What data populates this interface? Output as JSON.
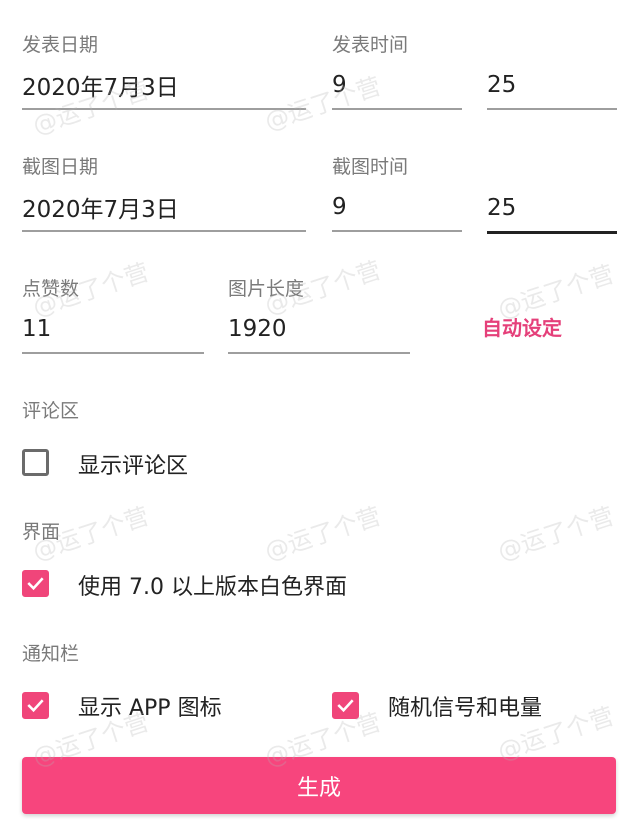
{
  "publish": {
    "date_label": "发表日期",
    "date_value": "2020年7月3日",
    "time_label": "发表时间",
    "hour": "9",
    "minute": "25"
  },
  "screenshot": {
    "date_label": "截图日期",
    "date_value": "2020年7月3日",
    "time_label": "截图时间",
    "hour": "9",
    "minute": "25"
  },
  "likes": {
    "label": "点赞数",
    "value": "11"
  },
  "image_length": {
    "label": "图片长度",
    "value": "1920"
  },
  "auto_set_label": "自动设定",
  "comments": {
    "section_label": "评论区",
    "show_label": "显示评论区",
    "checked": false
  },
  "interface": {
    "section_label": "界面",
    "white_ui_label": "使用 7.0 以上版本白色界面",
    "checked": true
  },
  "notification": {
    "section_label": "通知栏",
    "show_app_icon_label": "显示 APP 图标",
    "show_app_icon_checked": true,
    "random_signal_label": "随机信号和电量",
    "random_signal_checked": true
  },
  "generate_label": "生成",
  "watermark_text": "@运了个营",
  "colors": {
    "accent": "#f7457d",
    "link": "#e5407a",
    "label": "#7a7a7a",
    "text": "#222222"
  }
}
